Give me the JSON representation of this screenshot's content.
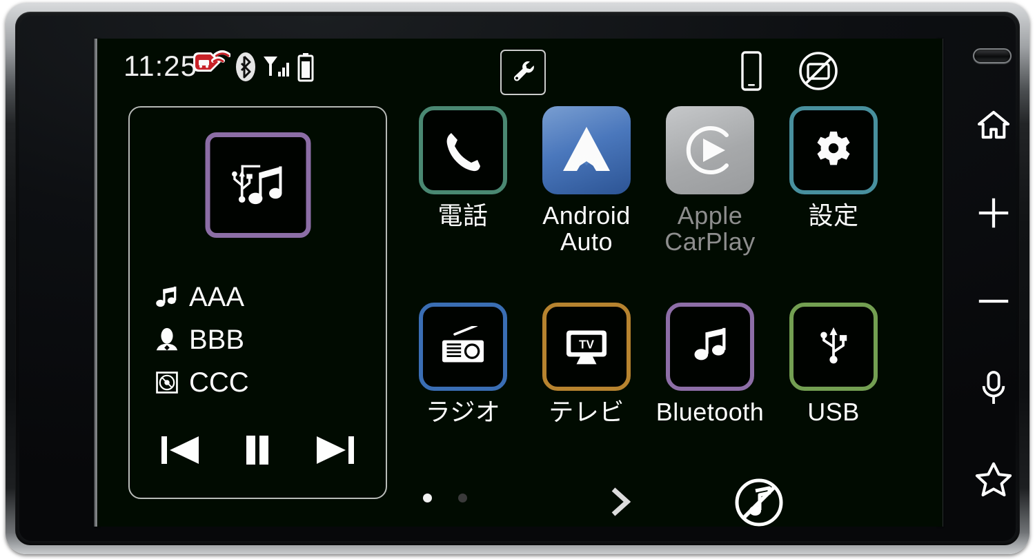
{
  "device": {
    "name": "car-head-unit",
    "screen_bg": "#010b01",
    "bezel_color": "#101214"
  },
  "status_bar": {
    "clock": "11:25",
    "icons": [
      {
        "name": "etc-dsrc-icon",
        "color": "#cc2229",
        "label": "ETC"
      },
      {
        "name": "bluetooth-icon",
        "color": "#ffffff",
        "label": "Bluetooth"
      },
      {
        "name": "signal-bars-icon",
        "color": "#ffffff",
        "label": "Signal"
      },
      {
        "name": "battery-icon",
        "color": "#ffffff",
        "label": "Battery"
      }
    ],
    "wrench_button": {
      "name": "wrench-tool-button",
      "label": "Tools"
    },
    "phone_status": {
      "name": "smartphone-icon",
      "label": "Smartphone connected"
    },
    "no_display_status": {
      "name": "no-display-icon",
      "label": "Display off"
    }
  },
  "media_panel": {
    "source": "USB Music",
    "album_art": {
      "name": "usb-music-art-icon",
      "border_color": "#8e6fa8"
    },
    "rows": [
      {
        "icon": "music-note-icon",
        "text": "AAA"
      },
      {
        "icon": "artist-person-icon",
        "text": "BBB"
      },
      {
        "icon": "album-disc-icon",
        "text": "CCC"
      }
    ],
    "transport": [
      {
        "name": "previous-track-button",
        "label": "Previous"
      },
      {
        "name": "pause-button",
        "label": "Pause"
      },
      {
        "name": "next-track-button",
        "label": "Next"
      }
    ]
  },
  "apps": [
    {
      "id": "phone",
      "label": "電話",
      "icon": "phone-handset-icon",
      "style": "outline",
      "tile_class": "tile-phone",
      "border": "#4b8a74",
      "disabled": false
    },
    {
      "id": "android_auto",
      "label": "Android\nAuto",
      "icon": "android-auto-icon",
      "style": "filled",
      "tile_class": "tile-aa",
      "border": "#4b79bf",
      "disabled": false
    },
    {
      "id": "apple_carplay",
      "label": "Apple\nCarPlay",
      "icon": "apple-carplay-icon",
      "style": "filled",
      "tile_class": "tile-cp",
      "border": "#a9abad",
      "disabled": true
    },
    {
      "id": "settings",
      "label": "設定",
      "icon": "gear-icon",
      "style": "outline",
      "tile_class": "tile-settings",
      "border": "#4992a0",
      "disabled": false
    },
    {
      "id": "radio",
      "label": "ラジオ",
      "icon": "radio-icon",
      "style": "outline",
      "tile_class": "tile-radio",
      "border": "#3a6fb5",
      "disabled": false
    },
    {
      "id": "tv",
      "label": "テレビ",
      "icon": "tv-icon",
      "style": "outline",
      "tile_class": "tile-tv",
      "border": "#b8842f",
      "disabled": false
    },
    {
      "id": "bluetooth",
      "label": "Bluetooth",
      "icon": "bluetooth-audio-icon",
      "style": "outline",
      "tile_class": "tile-bt",
      "border": "#8e6fa8",
      "disabled": false
    },
    {
      "id": "usb",
      "label": "USB",
      "icon": "usb-icon",
      "style": "outline",
      "tile_class": "tile-usb",
      "border": "#74a052",
      "disabled": false
    }
  ],
  "bottom_bar": {
    "pages": {
      "count": 2,
      "active_index": 0
    },
    "next_button": {
      "name": "next-page-button",
      "glyph": "›"
    },
    "mute_button": {
      "name": "mute-audio-button",
      "label": "Mute"
    }
  },
  "hardware_keys": [
    {
      "name": "mic-led-indicator",
      "label": "Microphone LED"
    },
    {
      "name": "home-button",
      "label": "Home"
    },
    {
      "name": "volume-up-button",
      "label": "Volume Up"
    },
    {
      "name": "volume-down-button",
      "label": "Volume Down"
    },
    {
      "name": "voice-command-button",
      "label": "Voice"
    },
    {
      "name": "favorite-button",
      "label": "Favorite"
    }
  ]
}
